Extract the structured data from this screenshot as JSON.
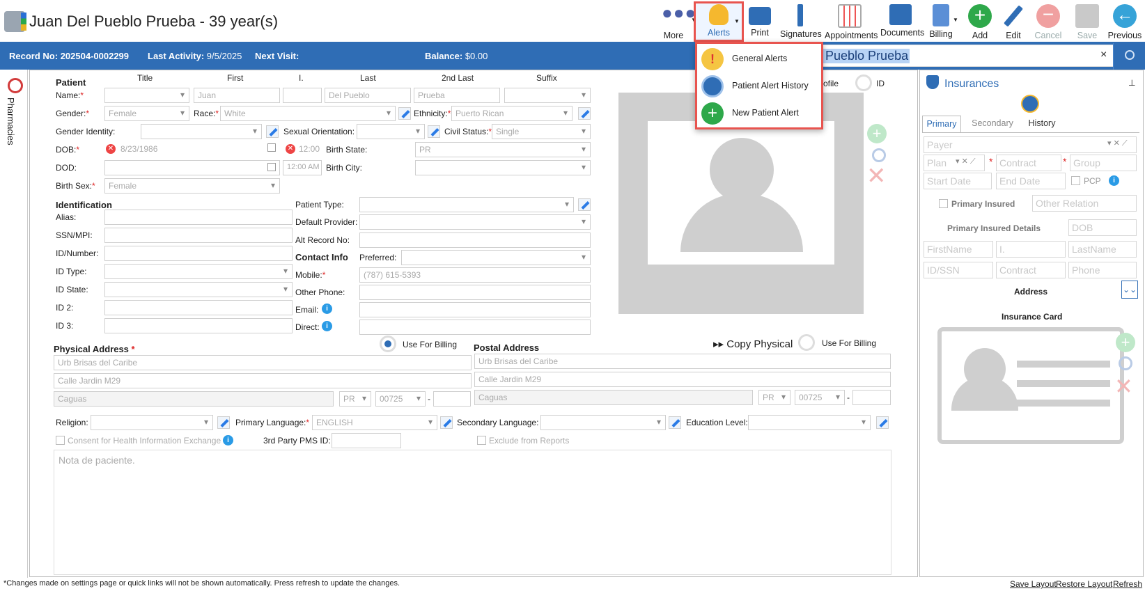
{
  "window": {
    "title": "Juan Del Pueblo Prueba - 39 year(s)"
  },
  "toolbar": {
    "items": [
      {
        "label": "More",
        "icon": "more-dots-icon"
      },
      {
        "label": "Alerts",
        "icon": "bell-icon"
      },
      {
        "label": "Print",
        "icon": "printer-icon"
      },
      {
        "label": "Signatures",
        "icon": "signature-pen-icon"
      },
      {
        "label": "Appointments",
        "icon": "calendar-icon"
      },
      {
        "label": "Documents",
        "icon": "documents-tray-icon"
      },
      {
        "label": "Billing",
        "icon": "billing-document-icon"
      },
      {
        "label": "Add",
        "icon": "plus-circle-icon"
      },
      {
        "label": "Edit",
        "icon": "pencil-icon"
      },
      {
        "label": "Cancel",
        "icon": "minus-circle-icon"
      },
      {
        "label": "Save",
        "icon": "floppy-disk-icon"
      },
      {
        "label": "Previous",
        "icon": "back-arrow-icon"
      }
    ],
    "colors": {
      "add": "#2ea84a",
      "cancel": "#f0a0a0",
      "previous": "#36a3d8",
      "alerts": "#f5b82e",
      "accent": "#2f6db5",
      "highlight": "#e8544f"
    }
  },
  "alerts_menu": {
    "items": [
      {
        "label": "General Alerts",
        "icon": "warning-circle-icon"
      },
      {
        "label": "Patient Alert History",
        "icon": "clock-warning-icon"
      },
      {
        "label": "New Patient Alert",
        "icon": "plus-circle-icon"
      }
    ]
  },
  "record_bar": {
    "record_label": "Record No:",
    "record_value": "202504-0002299",
    "activity_label": "Last Activity:",
    "activity_value": "9/5/2025",
    "next_visit_label": "Next Visit:",
    "balance_label": "Balance:",
    "balance_value": "$0.00",
    "search_value": "el Pueblo Prueba",
    "close": "×"
  },
  "sidebar": {
    "label": "Pharmacies"
  },
  "patient": {
    "section": "Patient",
    "cols": {
      "title": "Title",
      "first": "First",
      "initial": "I.",
      "last": "Last",
      "second_last": "2nd Last",
      "suffix": "Suffix"
    },
    "name_label": "Name:",
    "first": "Juan",
    "last": "Del Pueblo",
    "second_last": "Prueba",
    "gender_label": "Gender:",
    "gender": "Female",
    "race_label": "Race:",
    "race": "White",
    "ethnicity_label": "Ethnicity:",
    "ethnicity": "Puerto Rican",
    "gender_identity_label": "Gender Identity:",
    "sexual_orientation_label": "Sexual Orientation:",
    "civil_status_label": "Civil Status:",
    "civil_status": "Single",
    "dob_label": "DOB:",
    "dob": "8/23/1986",
    "dob_time": "12:00",
    "birth_state_label": "Birth State:",
    "birth_state": "PR",
    "dod_label": "DOD:",
    "dod_time": "12:00 AM",
    "birth_city_label": "Birth City:",
    "birth_sex_label": "Birth Sex:",
    "birth_sex": "Female"
  },
  "identification": {
    "section": "Identification",
    "alias": "Alias:",
    "ssn": "SSN/MPI:",
    "id_number": "ID/Number:",
    "id_type": "ID Type:",
    "id_state": "ID State:",
    "id2": "ID 2:",
    "id3": "ID 3:",
    "patient_type": "Patient Type:",
    "default_provider": "Default Provider:",
    "alt_record": "Alt Record No:"
  },
  "contact": {
    "section": "Contact Info",
    "preferred": "Preferred:",
    "mobile_label": "Mobile:",
    "mobile": "(787) 615-5393",
    "other_phone": "Other Phone:",
    "email": "Email:",
    "direct": "Direct:"
  },
  "photo": {
    "profile": "ofile",
    "id": "ID"
  },
  "physical_address": {
    "section": "Physical Address",
    "use_for_billing": "Use For Billing",
    "line1": "Urb Brisas del Caribe",
    "line2": "Calle Jardin M29",
    "city": "Caguas",
    "state": "PR",
    "zip": "00725"
  },
  "postal_address": {
    "section": "Postal Address",
    "copy_physical": "Copy Physical",
    "use_for_billing": "Use For Billing",
    "line1": "Urb Brisas del Caribe",
    "line2": "Calle Jardin M29",
    "city": "Caguas",
    "state": "PR",
    "zip": "00725"
  },
  "misc": {
    "religion": "Religion:",
    "primary_language_label": "Primary Language:",
    "primary_language": "ENGLISH",
    "secondary_language": "Secondary Language:",
    "education_level": "Education Level:",
    "consent": "Consent for Health Information Exchange",
    "pms": "3rd Party PMS ID:",
    "exclude": "Exclude from Reports",
    "notes_placeholder": "Nota de paciente."
  },
  "insurances": {
    "title": "Insurances",
    "tabs": [
      "Primary",
      "Secondary",
      "History"
    ],
    "payer": "Payer",
    "plan": "Plan",
    "contract": "Contract",
    "group": "Group",
    "start_date": "Start Date",
    "end_date": "End Date",
    "pcp": "PCP",
    "primary_insured": "Primary Insured",
    "other_relation": "Other Relation",
    "insured_details": "Primary Insured Details",
    "dob": "DOB",
    "firstname": "FirstName",
    "initial": "I.",
    "lastname": "LastName",
    "id_ssn": "ID/SSN",
    "contract2": "Contract",
    "phone": "Phone",
    "address": "Address",
    "insurance_card": "Insurance Card"
  },
  "footer": {
    "note": "*Changes made on settings page or quick links will not be shown automatically. Press refresh to update the changes.",
    "save_layout": "Save Layout",
    "restore_layout": "Restore Layout",
    "refresh": "Refresh"
  }
}
